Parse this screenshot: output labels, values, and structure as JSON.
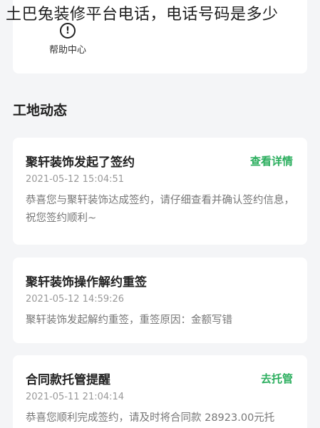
{
  "overlay_title": "土巴兔装修平台电话，电话号码是多少",
  "help": {
    "icon": "exclamation-circle-icon",
    "icon_glyph": "!",
    "label": "帮助中心"
  },
  "section_title": "工地动态",
  "colors": {
    "accent": "#2bae5e",
    "background": "#f4f5f7",
    "card": "#ffffff",
    "muted": "#999999"
  },
  "cards": [
    {
      "title": "聚轩装饰发起了签约",
      "action": "查看详情",
      "time": "2021-05-12 15:04:51",
      "body": "恭喜您与聚轩装饰达成签约，请仔细查看并确认签约信息，祝您签约顺利~"
    },
    {
      "title": "聚轩装饰操作解约重签",
      "action": "",
      "time": "2021-05-12 14:59:26",
      "body": "聚轩装饰发起解约重签，重签原因：金额写错"
    },
    {
      "title": "合同款托管提醒",
      "action": "去托管",
      "time": "2021-05-11 21:04:14",
      "body": "恭喜您顺利完成签约，请及时将合同款 28923.00元托"
    }
  ]
}
